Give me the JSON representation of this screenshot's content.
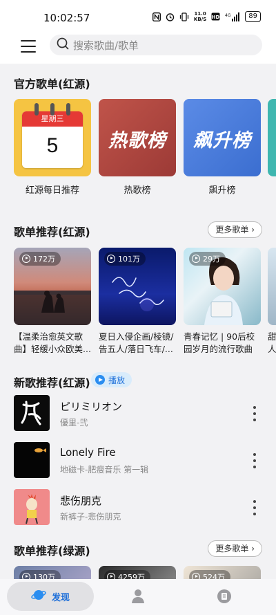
{
  "status_bar": {
    "time": "10:02:57",
    "net_speed_top": "11.0",
    "net_speed_unit": "KB/S",
    "signal": "4G",
    "battery": "89"
  },
  "top_bar": {
    "search_placeholder": "搜索歌曲/歌单"
  },
  "official": {
    "title": "官方歌单(红源)",
    "items": [
      {
        "label": "红源每日推荐",
        "calendar_weekday": "星期三",
        "calendar_day": "5"
      },
      {
        "label": "热歌榜",
        "cover_text": "热歌榜"
      },
      {
        "label": "飙升榜",
        "cover_text": "飙升榜"
      }
    ]
  },
  "playlist_red": {
    "title": "歌单推荐(红源)",
    "more": "更多歌单 ›",
    "items": [
      {
        "count": "172万",
        "title": "【温柔治愈英文歌曲】轻缓小众欧美..."
      },
      {
        "count": "101万",
        "title": "夏日入侵企画/棱镜/告五人/落日飞车/..."
      },
      {
        "count": "29万",
        "title": "青春记忆 | 90后校园岁月的流行歌曲"
      },
      {
        "title_peek": "甜人"
      }
    ]
  },
  "new_songs": {
    "title": "新歌推荐(红源)",
    "play_label": "播放",
    "items": [
      {
        "name": "ピリミリオン",
        "sub": "優里-弐"
      },
      {
        "name": "Lonely Fire",
        "sub": "地磁卡-肥瘦音乐 第一辑"
      },
      {
        "name": "悲伤朋克",
        "sub": "新裤子-悲伤朋克"
      }
    ]
  },
  "playlist_green": {
    "title": "歌单推荐(绿源)",
    "more": "更多歌单 ›",
    "counts": [
      "130万",
      "4259万",
      "524万"
    ]
  },
  "bottom_nav": {
    "discover_label": "发现"
  },
  "colors": {
    "accent": "#1e6fd9",
    "calendar_bg": "#f5c442",
    "hot_bg": "#b04840",
    "rise_bg": "#4a7fdd"
  }
}
